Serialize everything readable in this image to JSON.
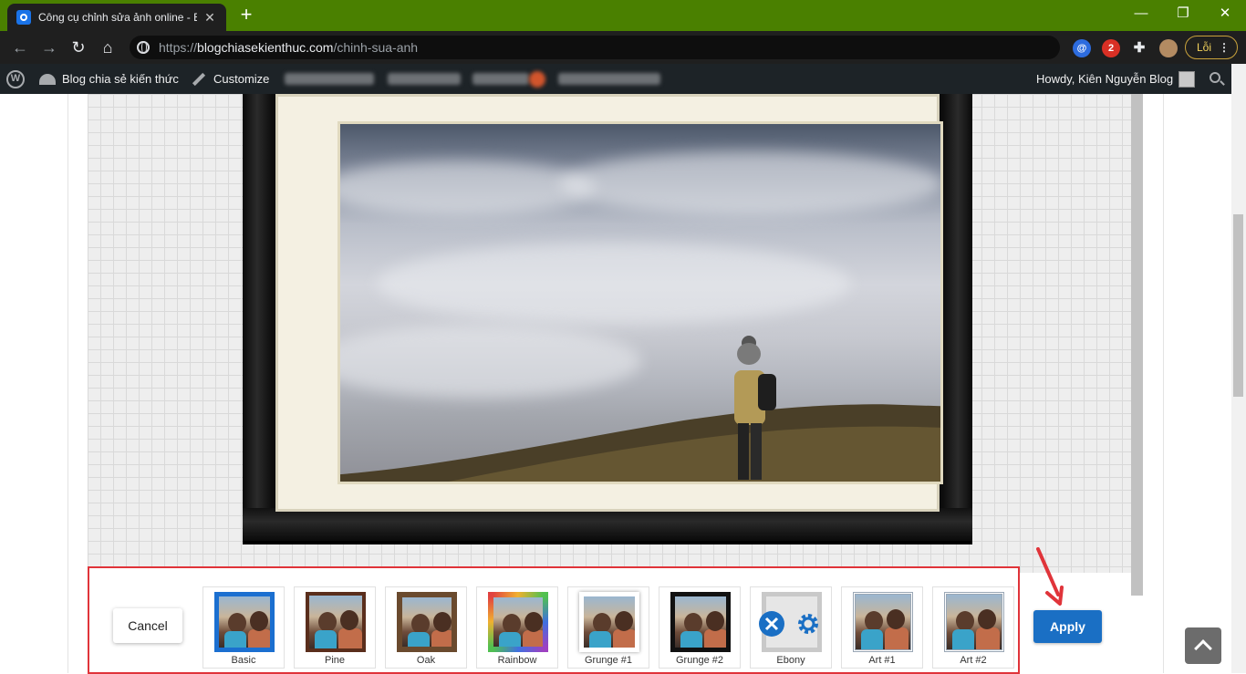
{
  "browser": {
    "tab_title": "Công cụ chỉnh sửa ảnh online - B",
    "tab_close": "✕",
    "new_tab": "+",
    "url_scheme": "https://",
    "url_host": "blogchiasekienthuc.com",
    "url_path": "/chinh-sua-anh",
    "ext_badge_count": "2",
    "error_label": "Lỗi",
    "menu_dots": "⋮",
    "window_controls": [
      "—",
      "❐",
      "✕"
    ]
  },
  "wp_admin_bar": {
    "site_name": "Blog chia sẻ kiến thức",
    "customize": "Customize",
    "greeting": "Howdy, Kiên Nguyễn Blog"
  },
  "editor": {
    "cancel_label": "Cancel",
    "apply_label": "Apply",
    "frames": [
      {
        "label": "Basic",
        "style": "basic",
        "border_color": "#1b6fd0"
      },
      {
        "label": "Pine",
        "style": "pine",
        "border_color": "#5a2e1c"
      },
      {
        "label": "Oak",
        "style": "oak",
        "border_color": "#6a4a2e"
      },
      {
        "label": "Rainbow",
        "style": "rainbow",
        "border_color": "#e04040"
      },
      {
        "label": "Grunge #1",
        "style": "grunge1",
        "border_color": "#ffffff"
      },
      {
        "label": "Grunge #2",
        "style": "grunge2",
        "border_color": "#111111"
      },
      {
        "label": "Ebony",
        "style": "ebony",
        "border_color": "#c9c9c9"
      },
      {
        "label": "Art #1",
        "style": "art1",
        "border_color": "#9aa7b5"
      },
      {
        "label": "Art #2",
        "style": "art2",
        "border_color": "#9aa7b5"
      }
    ]
  },
  "colors": {
    "titlebar": "#4a8000",
    "apply_button": "#1a6fc4",
    "highlight_border": "#e0343a"
  }
}
